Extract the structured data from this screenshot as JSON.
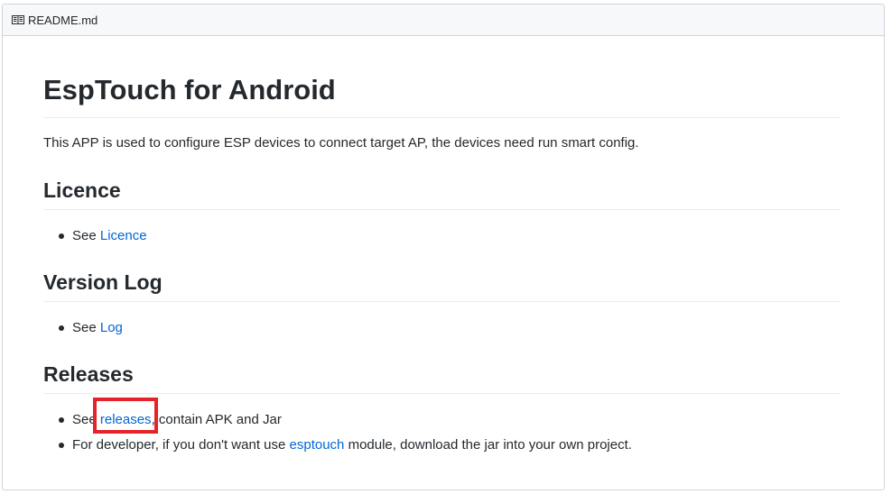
{
  "header": {
    "filename": "README.md"
  },
  "doc": {
    "title": "EspTouch for Android",
    "intro": "This APP is used to configure ESP devices to connect target AP, the devices need run smart config.",
    "sections": [
      {
        "heading": "Licence",
        "items": [
          {
            "prefix": "See ",
            "link": "Licence",
            "suffix": ""
          }
        ]
      },
      {
        "heading": "Version Log",
        "items": [
          {
            "prefix": "See ",
            "link": "Log",
            "suffix": ""
          }
        ]
      },
      {
        "heading": "Releases",
        "items": [
          {
            "prefix": "See ",
            "link": "releases",
            "suffix": ", contain APK and Jar"
          },
          {
            "prefix": "For developer, if you don't want use ",
            "link": "esptouch",
            "suffix": " module, download the jar into your own project."
          }
        ]
      }
    ]
  },
  "colors": {
    "link": "#0366d6",
    "highlight": "#e5232a",
    "text": "#24292e"
  },
  "icons": {
    "header_icon": "book-icon"
  }
}
